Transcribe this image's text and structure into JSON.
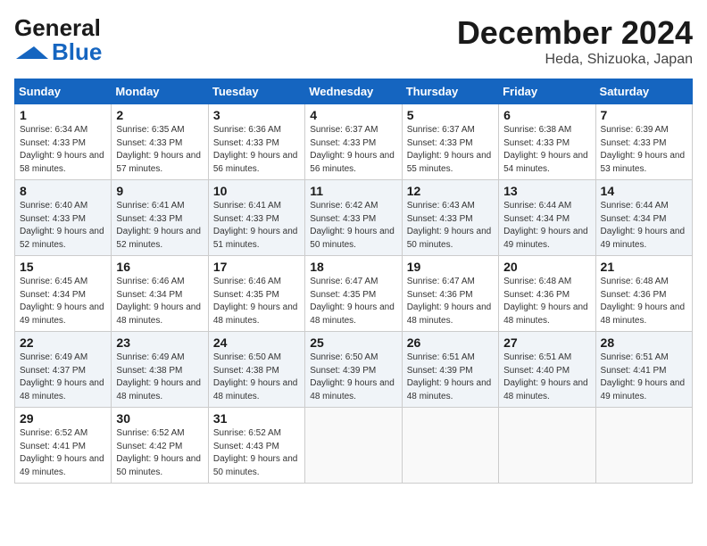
{
  "header": {
    "logo_line1": "General",
    "logo_line2": "Blue",
    "month": "December 2024",
    "location": "Heda, Shizuoka, Japan"
  },
  "weekdays": [
    "Sunday",
    "Monday",
    "Tuesday",
    "Wednesday",
    "Thursday",
    "Friday",
    "Saturday"
  ],
  "weeks": [
    [
      {
        "day": "1",
        "sunrise": "6:34 AM",
        "sunset": "4:33 PM",
        "daylight": "9 hours and 58 minutes."
      },
      {
        "day": "2",
        "sunrise": "6:35 AM",
        "sunset": "4:33 PM",
        "daylight": "9 hours and 57 minutes."
      },
      {
        "day": "3",
        "sunrise": "6:36 AM",
        "sunset": "4:33 PM",
        "daylight": "9 hours and 56 minutes."
      },
      {
        "day": "4",
        "sunrise": "6:37 AM",
        "sunset": "4:33 PM",
        "daylight": "9 hours and 56 minutes."
      },
      {
        "day": "5",
        "sunrise": "6:37 AM",
        "sunset": "4:33 PM",
        "daylight": "9 hours and 55 minutes."
      },
      {
        "day": "6",
        "sunrise": "6:38 AM",
        "sunset": "4:33 PM",
        "daylight": "9 hours and 54 minutes."
      },
      {
        "day": "7",
        "sunrise": "6:39 AM",
        "sunset": "4:33 PM",
        "daylight": "9 hours and 53 minutes."
      }
    ],
    [
      {
        "day": "8",
        "sunrise": "6:40 AM",
        "sunset": "4:33 PM",
        "daylight": "9 hours and 52 minutes."
      },
      {
        "day": "9",
        "sunrise": "6:41 AM",
        "sunset": "4:33 PM",
        "daylight": "9 hours and 52 minutes."
      },
      {
        "day": "10",
        "sunrise": "6:41 AM",
        "sunset": "4:33 PM",
        "daylight": "9 hours and 51 minutes."
      },
      {
        "day": "11",
        "sunrise": "6:42 AM",
        "sunset": "4:33 PM",
        "daylight": "9 hours and 50 minutes."
      },
      {
        "day": "12",
        "sunrise": "6:43 AM",
        "sunset": "4:33 PM",
        "daylight": "9 hours and 50 minutes."
      },
      {
        "day": "13",
        "sunrise": "6:44 AM",
        "sunset": "4:34 PM",
        "daylight": "9 hours and 49 minutes."
      },
      {
        "day": "14",
        "sunrise": "6:44 AM",
        "sunset": "4:34 PM",
        "daylight": "9 hours and 49 minutes."
      }
    ],
    [
      {
        "day": "15",
        "sunrise": "6:45 AM",
        "sunset": "4:34 PM",
        "daylight": "9 hours and 49 minutes."
      },
      {
        "day": "16",
        "sunrise": "6:46 AM",
        "sunset": "4:34 PM",
        "daylight": "9 hours and 48 minutes."
      },
      {
        "day": "17",
        "sunrise": "6:46 AM",
        "sunset": "4:35 PM",
        "daylight": "9 hours and 48 minutes."
      },
      {
        "day": "18",
        "sunrise": "6:47 AM",
        "sunset": "4:35 PM",
        "daylight": "9 hours and 48 minutes."
      },
      {
        "day": "19",
        "sunrise": "6:47 AM",
        "sunset": "4:36 PM",
        "daylight": "9 hours and 48 minutes."
      },
      {
        "day": "20",
        "sunrise": "6:48 AM",
        "sunset": "4:36 PM",
        "daylight": "9 hours and 48 minutes."
      },
      {
        "day": "21",
        "sunrise": "6:48 AM",
        "sunset": "4:36 PM",
        "daylight": "9 hours and 48 minutes."
      }
    ],
    [
      {
        "day": "22",
        "sunrise": "6:49 AM",
        "sunset": "4:37 PM",
        "daylight": "9 hours and 48 minutes."
      },
      {
        "day": "23",
        "sunrise": "6:49 AM",
        "sunset": "4:38 PM",
        "daylight": "9 hours and 48 minutes."
      },
      {
        "day": "24",
        "sunrise": "6:50 AM",
        "sunset": "4:38 PM",
        "daylight": "9 hours and 48 minutes."
      },
      {
        "day": "25",
        "sunrise": "6:50 AM",
        "sunset": "4:39 PM",
        "daylight": "9 hours and 48 minutes."
      },
      {
        "day": "26",
        "sunrise": "6:51 AM",
        "sunset": "4:39 PM",
        "daylight": "9 hours and 48 minutes."
      },
      {
        "day": "27",
        "sunrise": "6:51 AM",
        "sunset": "4:40 PM",
        "daylight": "9 hours and 48 minutes."
      },
      {
        "day": "28",
        "sunrise": "6:51 AM",
        "sunset": "4:41 PM",
        "daylight": "9 hours and 49 minutes."
      }
    ],
    [
      {
        "day": "29",
        "sunrise": "6:52 AM",
        "sunset": "4:41 PM",
        "daylight": "9 hours and 49 minutes."
      },
      {
        "day": "30",
        "sunrise": "6:52 AM",
        "sunset": "4:42 PM",
        "daylight": "9 hours and 50 minutes."
      },
      {
        "day": "31",
        "sunrise": "6:52 AM",
        "sunset": "4:43 PM",
        "daylight": "9 hours and 50 minutes."
      },
      null,
      null,
      null,
      null
    ]
  ]
}
